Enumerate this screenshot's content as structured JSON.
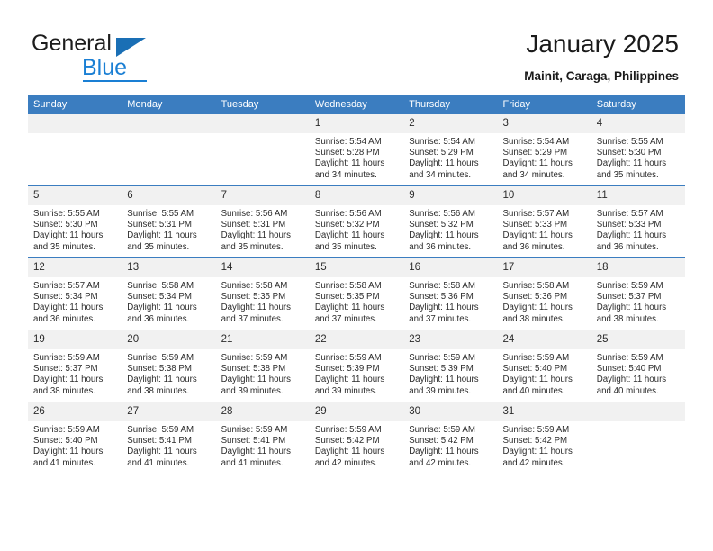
{
  "logo": {
    "word1": "General",
    "word2": "Blue",
    "triangle_color": "#1a6fb5",
    "blue_color": "#1a7fd4"
  },
  "header": {
    "title": "January 2025",
    "subtitle": "Mainit, Caraga, Philippines"
  },
  "theme": {
    "header_row_color": "#3b7dc0",
    "daynum_strip_color": "#f1f1f1",
    "text_color": "#2b2b2b"
  },
  "weekday_headers": [
    "Sunday",
    "Monday",
    "Tuesday",
    "Wednesday",
    "Thursday",
    "Friday",
    "Saturday"
  ],
  "weeks": [
    [
      {
        "day": "",
        "blank": true,
        "sunrise": "",
        "sunset": "",
        "daylight1": "",
        "daylight2": ""
      },
      {
        "day": "",
        "blank": true,
        "sunrise": "",
        "sunset": "",
        "daylight1": "",
        "daylight2": ""
      },
      {
        "day": "",
        "blank": true,
        "sunrise": "",
        "sunset": "",
        "daylight1": "",
        "daylight2": ""
      },
      {
        "day": "1",
        "sunrise": "Sunrise: 5:54 AM",
        "sunset": "Sunset: 5:28 PM",
        "daylight1": "Daylight: 11 hours",
        "daylight2": "and 34 minutes."
      },
      {
        "day": "2",
        "sunrise": "Sunrise: 5:54 AM",
        "sunset": "Sunset: 5:29 PM",
        "daylight1": "Daylight: 11 hours",
        "daylight2": "and 34 minutes."
      },
      {
        "day": "3",
        "sunrise": "Sunrise: 5:54 AM",
        "sunset": "Sunset: 5:29 PM",
        "daylight1": "Daylight: 11 hours",
        "daylight2": "and 34 minutes."
      },
      {
        "day": "4",
        "sunrise": "Sunrise: 5:55 AM",
        "sunset": "Sunset: 5:30 PM",
        "daylight1": "Daylight: 11 hours",
        "daylight2": "and 35 minutes."
      }
    ],
    [
      {
        "day": "5",
        "sunrise": "Sunrise: 5:55 AM",
        "sunset": "Sunset: 5:30 PM",
        "daylight1": "Daylight: 11 hours",
        "daylight2": "and 35 minutes."
      },
      {
        "day": "6",
        "sunrise": "Sunrise: 5:55 AM",
        "sunset": "Sunset: 5:31 PM",
        "daylight1": "Daylight: 11 hours",
        "daylight2": "and 35 minutes."
      },
      {
        "day": "7",
        "sunrise": "Sunrise: 5:56 AM",
        "sunset": "Sunset: 5:31 PM",
        "daylight1": "Daylight: 11 hours",
        "daylight2": "and 35 minutes."
      },
      {
        "day": "8",
        "sunrise": "Sunrise: 5:56 AM",
        "sunset": "Sunset: 5:32 PM",
        "daylight1": "Daylight: 11 hours",
        "daylight2": "and 35 minutes."
      },
      {
        "day": "9",
        "sunrise": "Sunrise: 5:56 AM",
        "sunset": "Sunset: 5:32 PM",
        "daylight1": "Daylight: 11 hours",
        "daylight2": "and 36 minutes."
      },
      {
        "day": "10",
        "sunrise": "Sunrise: 5:57 AM",
        "sunset": "Sunset: 5:33 PM",
        "daylight1": "Daylight: 11 hours",
        "daylight2": "and 36 minutes."
      },
      {
        "day": "11",
        "sunrise": "Sunrise: 5:57 AM",
        "sunset": "Sunset: 5:33 PM",
        "daylight1": "Daylight: 11 hours",
        "daylight2": "and 36 minutes."
      }
    ],
    [
      {
        "day": "12",
        "sunrise": "Sunrise: 5:57 AM",
        "sunset": "Sunset: 5:34 PM",
        "daylight1": "Daylight: 11 hours",
        "daylight2": "and 36 minutes."
      },
      {
        "day": "13",
        "sunrise": "Sunrise: 5:58 AM",
        "sunset": "Sunset: 5:34 PM",
        "daylight1": "Daylight: 11 hours",
        "daylight2": "and 36 minutes."
      },
      {
        "day": "14",
        "sunrise": "Sunrise: 5:58 AM",
        "sunset": "Sunset: 5:35 PM",
        "daylight1": "Daylight: 11 hours",
        "daylight2": "and 37 minutes."
      },
      {
        "day": "15",
        "sunrise": "Sunrise: 5:58 AM",
        "sunset": "Sunset: 5:35 PM",
        "daylight1": "Daylight: 11 hours",
        "daylight2": "and 37 minutes."
      },
      {
        "day": "16",
        "sunrise": "Sunrise: 5:58 AM",
        "sunset": "Sunset: 5:36 PM",
        "daylight1": "Daylight: 11 hours",
        "daylight2": "and 37 minutes."
      },
      {
        "day": "17",
        "sunrise": "Sunrise: 5:58 AM",
        "sunset": "Sunset: 5:36 PM",
        "daylight1": "Daylight: 11 hours",
        "daylight2": "and 38 minutes."
      },
      {
        "day": "18",
        "sunrise": "Sunrise: 5:59 AM",
        "sunset": "Sunset: 5:37 PM",
        "daylight1": "Daylight: 11 hours",
        "daylight2": "and 38 minutes."
      }
    ],
    [
      {
        "day": "19",
        "sunrise": "Sunrise: 5:59 AM",
        "sunset": "Sunset: 5:37 PM",
        "daylight1": "Daylight: 11 hours",
        "daylight2": "and 38 minutes."
      },
      {
        "day": "20",
        "sunrise": "Sunrise: 5:59 AM",
        "sunset": "Sunset: 5:38 PM",
        "daylight1": "Daylight: 11 hours",
        "daylight2": "and 38 minutes."
      },
      {
        "day": "21",
        "sunrise": "Sunrise: 5:59 AM",
        "sunset": "Sunset: 5:38 PM",
        "daylight1": "Daylight: 11 hours",
        "daylight2": "and 39 minutes."
      },
      {
        "day": "22",
        "sunrise": "Sunrise: 5:59 AM",
        "sunset": "Sunset: 5:39 PM",
        "daylight1": "Daylight: 11 hours",
        "daylight2": "and 39 minutes."
      },
      {
        "day": "23",
        "sunrise": "Sunrise: 5:59 AM",
        "sunset": "Sunset: 5:39 PM",
        "daylight1": "Daylight: 11 hours",
        "daylight2": "and 39 minutes."
      },
      {
        "day": "24",
        "sunrise": "Sunrise: 5:59 AM",
        "sunset": "Sunset: 5:40 PM",
        "daylight1": "Daylight: 11 hours",
        "daylight2": "and 40 minutes."
      },
      {
        "day": "25",
        "sunrise": "Sunrise: 5:59 AM",
        "sunset": "Sunset: 5:40 PM",
        "daylight1": "Daylight: 11 hours",
        "daylight2": "and 40 minutes."
      }
    ],
    [
      {
        "day": "26",
        "sunrise": "Sunrise: 5:59 AM",
        "sunset": "Sunset: 5:40 PM",
        "daylight1": "Daylight: 11 hours",
        "daylight2": "and 41 minutes."
      },
      {
        "day": "27",
        "sunrise": "Sunrise: 5:59 AM",
        "sunset": "Sunset: 5:41 PM",
        "daylight1": "Daylight: 11 hours",
        "daylight2": "and 41 minutes."
      },
      {
        "day": "28",
        "sunrise": "Sunrise: 5:59 AM",
        "sunset": "Sunset: 5:41 PM",
        "daylight1": "Daylight: 11 hours",
        "daylight2": "and 41 minutes."
      },
      {
        "day": "29",
        "sunrise": "Sunrise: 5:59 AM",
        "sunset": "Sunset: 5:42 PM",
        "daylight1": "Daylight: 11 hours",
        "daylight2": "and 42 minutes."
      },
      {
        "day": "30",
        "sunrise": "Sunrise: 5:59 AM",
        "sunset": "Sunset: 5:42 PM",
        "daylight1": "Daylight: 11 hours",
        "daylight2": "and 42 minutes."
      },
      {
        "day": "31",
        "sunrise": "Sunrise: 5:59 AM",
        "sunset": "Sunset: 5:42 PM",
        "daylight1": "Daylight: 11 hours",
        "daylight2": "and 42 minutes."
      },
      {
        "day": "",
        "blank": true,
        "sunrise": "",
        "sunset": "",
        "daylight1": "",
        "daylight2": ""
      }
    ]
  ]
}
